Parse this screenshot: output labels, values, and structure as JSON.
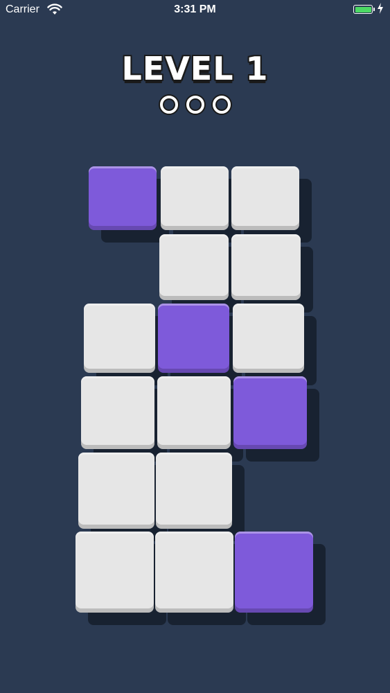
{
  "status_bar": {
    "carrier": "Carrier",
    "time": "3:31 PM",
    "wifi_icon": "wifi-icon",
    "battery_icon": "battery-icon",
    "charging_icon": "bolt-icon",
    "battery_color": "#4cd964"
  },
  "header": {
    "title": "LEVEL 1",
    "progress": {
      "total": 3,
      "completed": 0
    }
  },
  "colors": {
    "background": "#2b3a52",
    "tile_white": "#e6e6e6",
    "tile_purple": "#7e5ada"
  },
  "board": {
    "grid": [
      [
        "purple",
        "white",
        "white"
      ],
      [
        null,
        "white",
        "white"
      ],
      [
        "white",
        "purple",
        "white"
      ],
      [
        "white",
        "white",
        "purple"
      ],
      [
        "white",
        "white",
        null
      ],
      [
        "white",
        "white",
        "purple"
      ]
    ]
  }
}
